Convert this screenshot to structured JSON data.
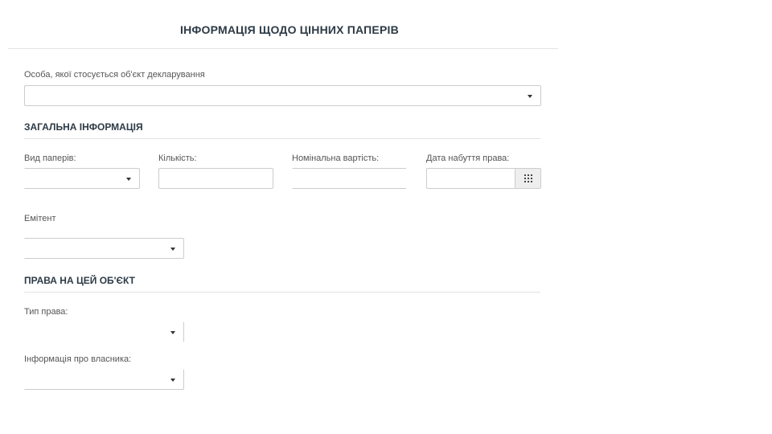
{
  "page": {
    "title": "ІНФОРМАЦІЯ ЩОДО ЦІННИХ ПАПЕРІВ"
  },
  "person": {
    "label": "Особа, якої стосується об'єкт декларування",
    "value": ""
  },
  "general": {
    "heading": "ЗАГАЛЬНА ІНФОРМАЦІЯ",
    "paper_type": {
      "label": "Вид паперів:",
      "value": ""
    },
    "quantity": {
      "label": "Кількість:",
      "value": ""
    },
    "nominal": {
      "label": "Номінальна вартість:",
      "value": ""
    },
    "acquired_date": {
      "label": "Дата набуття права:",
      "value": "",
      "icon": "calendar-icon"
    },
    "issuer": {
      "label": "Емітент",
      "value": ""
    }
  },
  "rights": {
    "heading": "ПРАВА НА ЦЕЙ ОБ'ЄКТ",
    "right_type": {
      "label": "Тип права:",
      "value": ""
    },
    "owner_info": {
      "label": "Інформація про власника:",
      "value": ""
    }
  }
}
